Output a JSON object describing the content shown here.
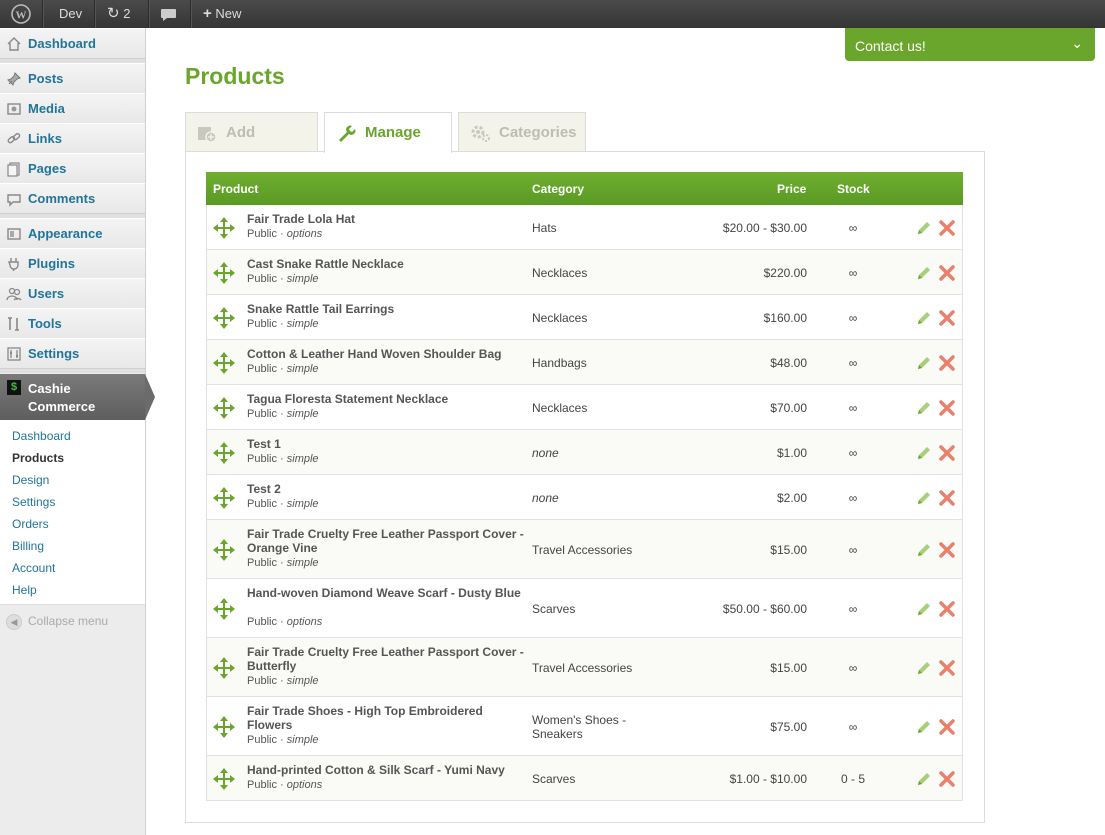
{
  "admin_bar": {
    "site_name": "Dev",
    "updates_count": "2",
    "new_label": "New"
  },
  "menu": {
    "items": [
      {
        "label": "Dashboard",
        "icon": "house-icon"
      },
      {
        "label": "Posts",
        "icon": "pushpin-icon"
      },
      {
        "label": "Media",
        "icon": "media-icon"
      },
      {
        "label": "Links",
        "icon": "chain-link-icon"
      },
      {
        "label": "Pages",
        "icon": "pages-icon"
      },
      {
        "label": "Comments",
        "icon": "speech-bubble-icon"
      },
      {
        "label": "Appearance",
        "icon": "appearance-icon"
      },
      {
        "label": "Plugins",
        "icon": "plug-icon"
      },
      {
        "label": "Users",
        "icon": "users-icon"
      },
      {
        "label": "Tools",
        "icon": "tools-icon"
      },
      {
        "label": "Settings",
        "icon": "settings-icon"
      }
    ],
    "cashie": {
      "label_line1": "Cashie",
      "label_line2": "Commerce",
      "icon_glyph": "$"
    },
    "submenu": [
      "Dashboard",
      "Products",
      "Design",
      "Settings",
      "Orders",
      "Billing",
      "Account",
      "Help"
    ],
    "submenu_current": "Products",
    "collapse_label": "Collapse menu"
  },
  "contact": {
    "label": "Contact us!"
  },
  "page": {
    "title": "Products"
  },
  "tabs": [
    {
      "label": "Add",
      "icon": "add-product-icon",
      "active": false
    },
    {
      "label": "Manage",
      "icon": "wrench-icon",
      "active": true
    },
    {
      "label": "Categories",
      "icon": "gears-icon",
      "active": false
    }
  ],
  "table": {
    "headers": {
      "product": "Product",
      "category": "Category",
      "price": "Price",
      "stock": "Stock"
    },
    "rows": [
      {
        "name": "Fair Trade Lola Hat",
        "visibility": "Public",
        "type": "options",
        "category": "Hats",
        "price": "$20.00 - $30.00",
        "stock": "∞"
      },
      {
        "name": "Cast Snake Rattle Necklace",
        "visibility": "Public",
        "type": "simple",
        "category": "Necklaces",
        "price": "$220.00",
        "stock": "∞"
      },
      {
        "name": "Snake Rattle Tail Earrings",
        "visibility": "Public",
        "type": "simple",
        "category": "Necklaces",
        "price": "$160.00",
        "stock": "∞"
      },
      {
        "name": "Cotton & Leather Hand Woven Shoulder Bag",
        "visibility": "Public",
        "type": "simple",
        "category": "Handbags",
        "price": "$48.00",
        "stock": "∞"
      },
      {
        "name": "Tagua Floresta Statement Necklace",
        "visibility": "Public",
        "type": "simple",
        "category": "Necklaces",
        "price": "$70.00",
        "stock": "∞"
      },
      {
        "name": "Test 1",
        "visibility": "Public",
        "type": "simple",
        "category": "none",
        "price": "$1.00",
        "stock": "∞"
      },
      {
        "name": "Test 2",
        "visibility": "Public",
        "type": "simple",
        "category": "none",
        "price": "$2.00",
        "stock": "∞"
      },
      {
        "name": "Fair Trade Cruelty Free Leather Passport Cover - Orange Vine",
        "visibility": "Public",
        "type": "simple",
        "category": "Travel Accessories",
        "price": "$15.00",
        "stock": "∞"
      },
      {
        "name": "Hand-woven Diamond Weave Scarf - Dusty Blue",
        "visibility": "Public",
        "type": "options",
        "category": "Scarves",
        "price": "$50.00 - $60.00",
        "stock": "∞"
      },
      {
        "name": "Fair Trade Cruelty Free Leather Passport Cover - Butterfly",
        "visibility": "Public",
        "type": "simple",
        "category": "Travel Accessories",
        "price": "$15.00",
        "stock": "∞"
      },
      {
        "name": "Fair Trade Shoes - High Top Embroidered Flowers",
        "visibility": "Public",
        "type": "simple",
        "category": "Women's Shoes - Sneakers",
        "price": "$75.00",
        "stock": "∞"
      },
      {
        "name": "Hand-printed Cotton & Silk Scarf - Yumi Navy",
        "visibility": "Public",
        "type": "options",
        "category": "Scarves",
        "price": "$1.00 - $10.00",
        "stock": "0 - 5"
      }
    ]
  },
  "colors": {
    "accent": "#6aa52c",
    "link": "#21759b",
    "delete": "#e8806a"
  }
}
